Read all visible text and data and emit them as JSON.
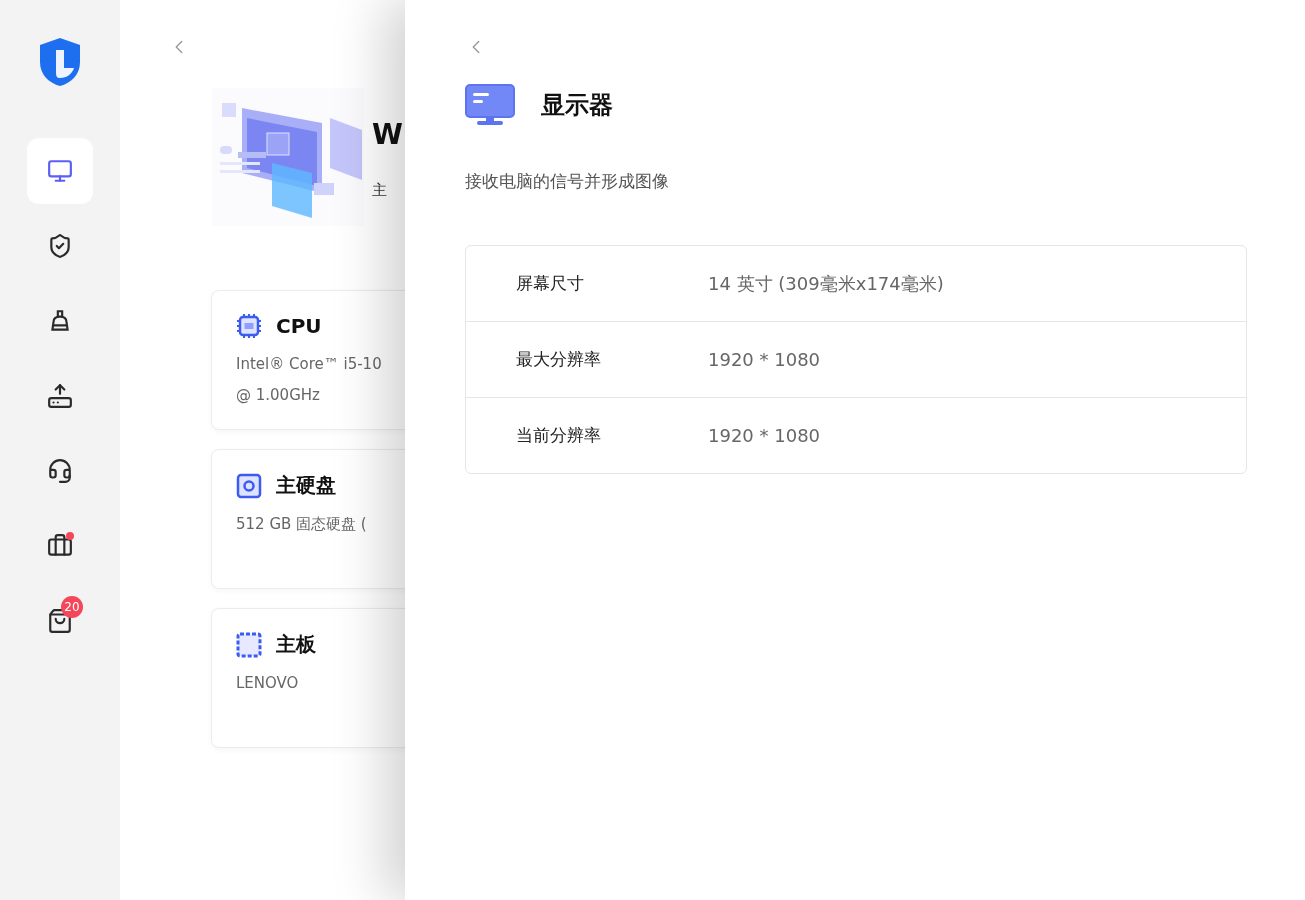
{
  "sidebar": {
    "items": [
      {
        "kind": "computer",
        "selected": true,
        "dot": false
      },
      {
        "kind": "security",
        "selected": false,
        "dot": false
      },
      {
        "kind": "cleanup",
        "selected": false,
        "dot": false
      },
      {
        "kind": "drive",
        "selected": false,
        "dot": false
      },
      {
        "kind": "support",
        "selected": false,
        "dot": false
      },
      {
        "kind": "toolbox",
        "selected": false,
        "dot": true
      },
      {
        "kind": "store",
        "selected": false,
        "dot": false,
        "badge": "20"
      }
    ]
  },
  "background_page": {
    "title": "W",
    "subtitle": "主",
    "cards": [
      {
        "kind": "cpu",
        "title": "CPU",
        "detail": [
          "Intel® Core™ i5-10",
          "@ 1.00GHz"
        ]
      },
      {
        "kind": "disk",
        "title": "主硬盘",
        "detail": [
          "512 GB 固态硬盘 ("
        ]
      },
      {
        "kind": "board",
        "title": "主板",
        "detail": [
          "LENOVO"
        ]
      }
    ]
  },
  "drawer": {
    "title": "显示器",
    "description": "接收电脑的信号并形成图像",
    "specs": [
      {
        "label": "屏幕尺寸",
        "value": "14 英寸 (309毫米x174毫米)"
      },
      {
        "label": "最大分辨率",
        "value": "1920 * 1080"
      },
      {
        "label": "当前分辨率",
        "value": "1920 * 1080"
      }
    ]
  }
}
